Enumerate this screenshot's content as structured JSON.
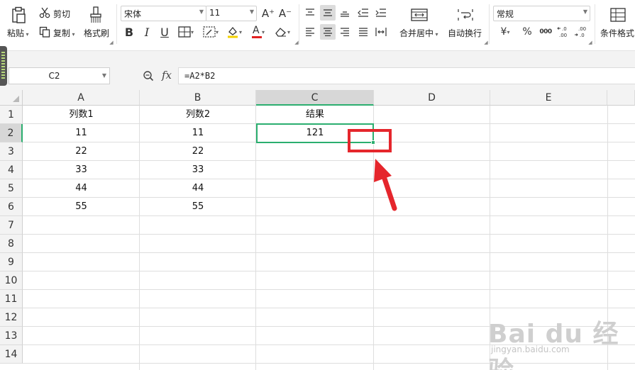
{
  "ribbon": {
    "paste": "粘贴",
    "cut": "剪切",
    "copy": "复制",
    "format_painter": "格式刷",
    "font_name": "宋体",
    "font_size": "11",
    "merge_center": "合并居中",
    "wrap_text": "自动换行",
    "number_format": "常规",
    "conditional_format": "条件格式",
    "currency_symbol": "¥",
    "percent_symbol": "%",
    "thousands_symbol": "000",
    "bold_glyph": "B",
    "italic_glyph": "I",
    "underline_glyph": "U",
    "font_color_glyph": "A",
    "grow_font_glyph": "A⁺",
    "shrink_font_glyph": "A⁻"
  },
  "formula_bar": {
    "name_box": "C2",
    "fx_label": "fx",
    "formula": "=A2*B2"
  },
  "sheet": {
    "columns": [
      "A",
      "B",
      "C",
      "D",
      "E"
    ],
    "selected_column": "C",
    "rows": [
      "1",
      "2",
      "3",
      "4",
      "5",
      "6",
      "7",
      "8",
      "9",
      "10",
      "11",
      "12",
      "13",
      "14"
    ],
    "selected_row": "2",
    "header_row": [
      "列数1",
      "列数2",
      "结果"
    ],
    "data": [
      [
        "11",
        "11",
        "121"
      ],
      [
        "22",
        "22",
        ""
      ],
      [
        "33",
        "33",
        ""
      ],
      [
        "44",
        "44",
        ""
      ],
      [
        "55",
        "55",
        ""
      ]
    ],
    "selection_color": "#2bae6f"
  },
  "annotation": {
    "highlight_color": "#e5262c"
  },
  "watermark": {
    "brand": "Bai du 经验",
    "site": "jingyan.baidu.com"
  }
}
